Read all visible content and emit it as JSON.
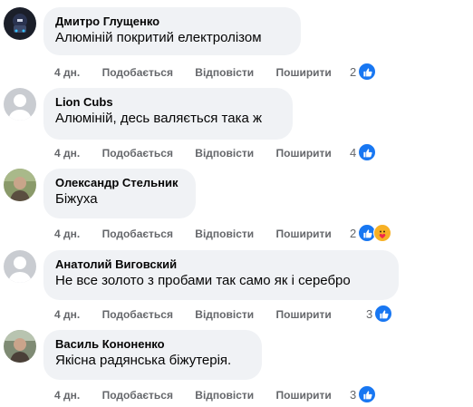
{
  "comments": [
    {
      "author": "Дмитро Глущенко",
      "text": "Алюміній покритий електролізом",
      "time": "4 дн.",
      "like": "Подобається",
      "reply": "Відповісти",
      "share": "Поширити",
      "reactions_count": "2",
      "reaction_icons": [
        "like-icon"
      ]
    },
    {
      "author": "Lion Cubs",
      "text": "Алюміній, десь валяється така ж",
      "time": "4 дн.",
      "like": "Подобається",
      "reply": "Відповісти",
      "share": "Поширити",
      "reactions_count": "4",
      "reaction_icons": [
        "like-icon"
      ]
    },
    {
      "author": "Олександр Стельник",
      "text": "Біжуха",
      "time": "4 дн.",
      "like": "Подобається",
      "reply": "Відповісти",
      "share": "Поширити",
      "reactions_count": "2",
      "reaction_icons": [
        "like-icon",
        "care-icon"
      ]
    },
    {
      "author": "Анатолий Виговский",
      "text": "Не все золото з пробами так само як і серебро",
      "time": "4 дн.",
      "like": "Подобається",
      "reply": "Відповісти",
      "share": "Поширити",
      "reactions_count": "3",
      "reaction_icons": [
        "like-icon"
      ]
    },
    {
      "author": "Василь Кононенко",
      "text": "Якісна радянська біжутерія.",
      "time": "4 дн.",
      "like": "Подобається",
      "reply": "Відповісти",
      "share": "Поширити",
      "reactions_count": "3",
      "reaction_icons": [
        "like-icon"
      ]
    }
  ],
  "colors": {
    "bubble": "#f0f2f5",
    "like_blue": "#1877f2",
    "meta_gray": "#65676b",
    "text": "#050505"
  }
}
